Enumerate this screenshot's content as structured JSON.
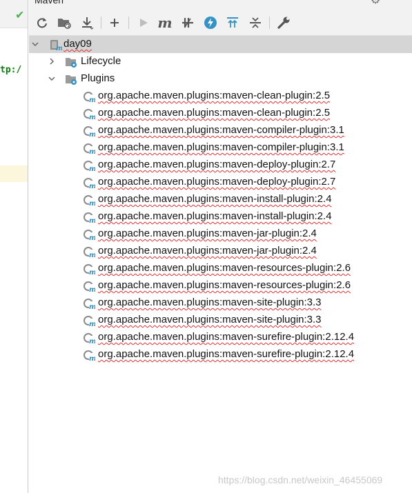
{
  "panel": {
    "title": "Maven"
  },
  "editor": {
    "code_snippet": "tp:/"
  },
  "toolbar": {
    "buttons": [
      {
        "name": "reload-icon"
      },
      {
        "name": "generate-sources-icon"
      },
      {
        "name": "download-icon"
      },
      {
        "name": "add-icon"
      },
      {
        "name": "run-icon"
      },
      {
        "name": "execute-goal-icon"
      },
      {
        "name": "skip-tests-icon"
      },
      {
        "name": "offline-icon"
      },
      {
        "name": "show-dependencies-icon"
      },
      {
        "name": "collapse-all-icon"
      },
      {
        "name": "settings-wrench-icon"
      }
    ]
  },
  "tree": {
    "project": "day09",
    "lifecycle": "Lifecycle",
    "plugins": "Plugins",
    "plugin_items": [
      "org.apache.maven.plugins:maven-clean-plugin:2.5",
      "org.apache.maven.plugins:maven-clean-plugin:2.5",
      "org.apache.maven.plugins:maven-compiler-plugin:3.1",
      "org.apache.maven.plugins:maven-compiler-plugin:3.1",
      "org.apache.maven.plugins:maven-deploy-plugin:2.7",
      "org.apache.maven.plugins:maven-deploy-plugin:2.7",
      "org.apache.maven.plugins:maven-install-plugin:2.4",
      "org.apache.maven.plugins:maven-install-plugin:2.4",
      "org.apache.maven.plugins:maven-jar-plugin:2.4",
      "org.apache.maven.plugins:maven-jar-plugin:2.4",
      "org.apache.maven.plugins:maven-resources-plugin:2.6",
      "org.apache.maven.plugins:maven-resources-plugin:2.6",
      "org.apache.maven.plugins:maven-site-plugin:3.3",
      "org.apache.maven.plugins:maven-site-plugin:3.3",
      "org.apache.maven.plugins:maven-surefire-plugin:2.12.4",
      "org.apache.maven.plugins:maven-surefire-plugin:2.12.4"
    ]
  },
  "watermark": "https://blog.csdn.net/weixin_46455069",
  "colors": {
    "accent_blue": "#3592c4",
    "error_underline": "#e03131",
    "selection": "#d5d5d5"
  }
}
